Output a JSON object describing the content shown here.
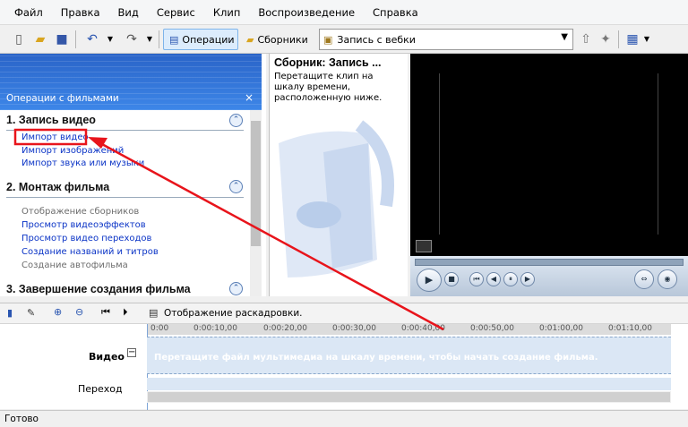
{
  "menu": [
    "Файл",
    "Правка",
    "Вид",
    "Сервис",
    "Клип",
    "Воспроизведение",
    "Справка"
  ],
  "toolbar": {
    "operations": "Операции",
    "collections": "Сборники",
    "combo_value": "Запись с вебки"
  },
  "tasks_pane": {
    "title": "Операции с фильмами",
    "sections": [
      {
        "title": "1. Запись видео",
        "items": [
          {
            "label": "Импорт видео",
            "link": true
          },
          {
            "label": "Импорт изображений",
            "link": true
          },
          {
            "label": "Импорт звука или музыки",
            "link": true
          }
        ]
      },
      {
        "title": "2. Монтаж фильма",
        "items": [
          {
            "label": "Отображение сборников",
            "link": false
          },
          {
            "label": "Просмотр видеоэффектов",
            "link": true
          },
          {
            "label": "Просмотр видео переходов",
            "link": true
          },
          {
            "label": "Создание названий и титров",
            "link": true
          },
          {
            "label": "Создание автофильма",
            "link": false
          }
        ]
      },
      {
        "title": "3. Завершение создания фильма"
      }
    ]
  },
  "collection": {
    "title": "Сборник: Запись ...",
    "description": "Перетащите клип на шкалу времени, расположенную ниже."
  },
  "storyboard": {
    "label": "Отображение раскадровки."
  },
  "timeline": {
    "ticks": [
      "0:00",
      "0:00:10,00",
      "0:00:20,00",
      "0:00:30,00",
      "0:00:40,00",
      "0:00:50,00",
      "0:01:00,00",
      "0:01:10,00"
    ],
    "video_label": "Видео",
    "transition_label": "Переход",
    "video_hint": "Перетащите файл мультимедиа на шкалу времени, чтобы начать создание фильма."
  },
  "status": "Готово",
  "colors": {
    "accent": "#2a64c8",
    "link": "#0b34c6",
    "annotation": "#e8141b"
  }
}
